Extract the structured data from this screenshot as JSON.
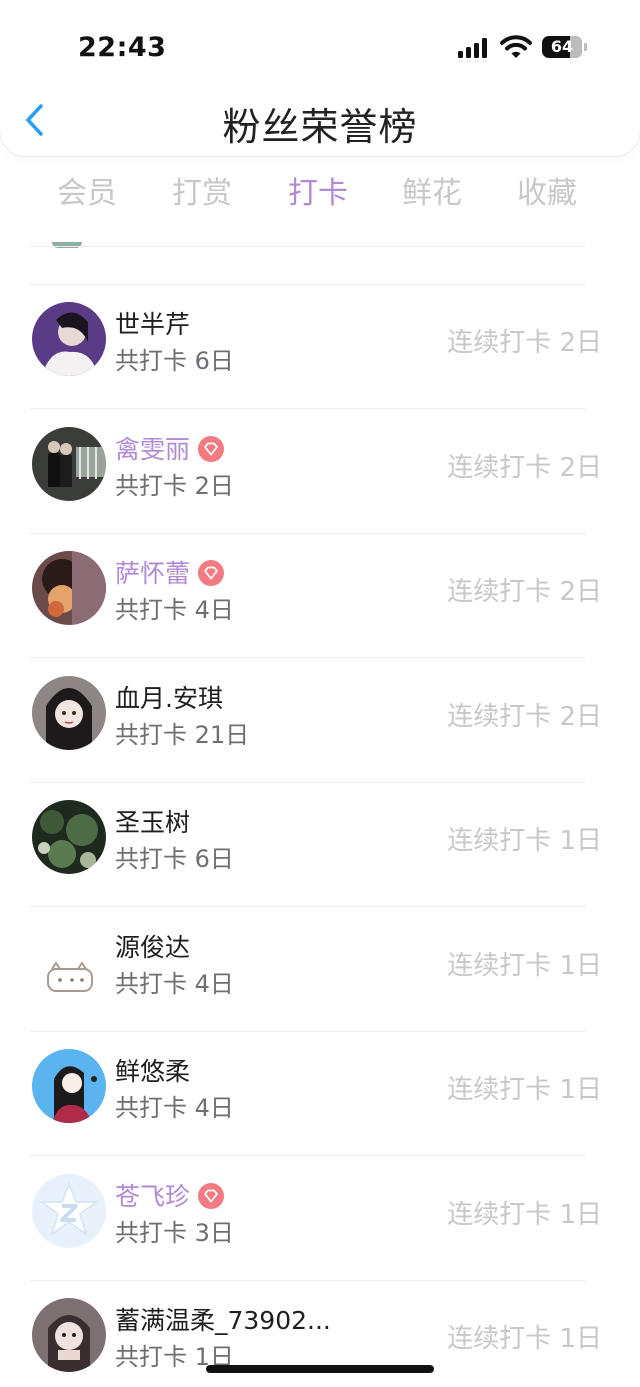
{
  "status_bar": {
    "time": "22:43",
    "battery": "64"
  },
  "header": {
    "title": "粉丝荣誉榜",
    "back_icon": "chevron-left-icon"
  },
  "tabs": [
    {
      "label": "会员",
      "active": false
    },
    {
      "label": "打赏",
      "active": false
    },
    {
      "label": "打卡",
      "active": true
    },
    {
      "label": "鲜花",
      "active": false
    },
    {
      "label": "收藏",
      "active": false
    }
  ],
  "colors": {
    "accent": "#b18ad6",
    "muted": "#c7c7cc",
    "gem": "#f25f6b"
  },
  "fans": [
    {
      "name": "世半芹",
      "vip": false,
      "total": "共打卡 6日",
      "streak": "连续打卡 2日"
    },
    {
      "name": "禽雯丽",
      "vip": true,
      "total": "共打卡 2日",
      "streak": "连续打卡 2日"
    },
    {
      "name": "萨怀蕾",
      "vip": true,
      "total": "共打卡 4日",
      "streak": "连续打卡 2日"
    },
    {
      "name": "血月.安琪",
      "vip": false,
      "total": "共打卡 21日",
      "streak": "连续打卡 2日"
    },
    {
      "name": "圣玉树",
      "vip": false,
      "total": "共打卡 6日",
      "streak": "连续打卡 1日"
    },
    {
      "name": "源俊达",
      "vip": false,
      "total": "共打卡 4日",
      "streak": "连续打卡 1日"
    },
    {
      "name": "鲜悠柔",
      "vip": false,
      "total": "共打卡 4日",
      "streak": "连续打卡 1日"
    },
    {
      "name": "苍飞珍",
      "vip": true,
      "total": "共打卡 3日",
      "streak": "连续打卡 1日"
    },
    {
      "name": "蓄满温柔_73902...",
      "vip": false,
      "total": "共打卡 1日",
      "streak": "连续打卡 1日"
    }
  ]
}
